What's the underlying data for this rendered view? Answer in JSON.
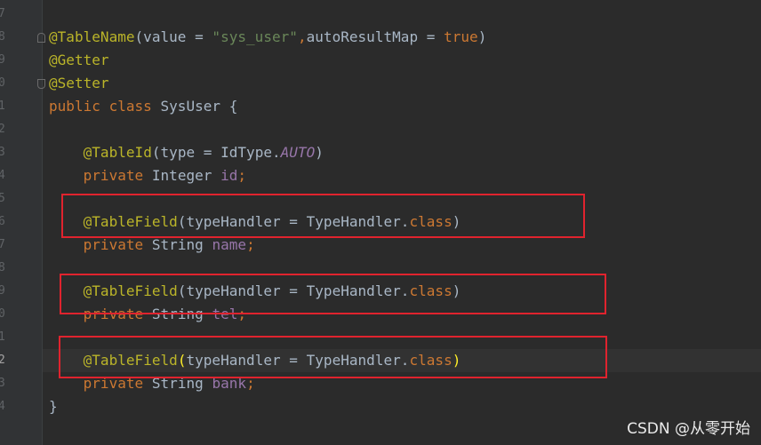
{
  "editor": {
    "line_numbers": [
      "7",
      "8",
      "9",
      "0",
      "1",
      "2",
      "3",
      "4",
      "5",
      "6",
      "7",
      "8",
      "9",
      "0",
      "1",
      "2",
      "3",
      "4"
    ],
    "active_line_index": 15,
    "lines": [
      [],
      [
        [
          "ann",
          "@TableName"
        ],
        [
          "plain",
          "(value = "
        ],
        [
          "str",
          "\"sys_user\""
        ],
        [
          "kw",
          ","
        ],
        [
          "plain",
          "autoResultMap = "
        ],
        [
          "kw",
          "true"
        ],
        [
          "plain",
          ")"
        ]
      ],
      [
        [
          "ann",
          "@Getter"
        ]
      ],
      [
        [
          "ann",
          "@Setter"
        ]
      ],
      [
        [
          "kw",
          "public class "
        ],
        [
          "plain",
          "SysUser {"
        ]
      ],
      [],
      [
        [
          "plain",
          "    "
        ],
        [
          "ann",
          "@TableId"
        ],
        [
          "plain",
          "(type = IdType."
        ],
        [
          "italic",
          "AUTO"
        ],
        [
          "plain",
          ")"
        ]
      ],
      [
        [
          "plain",
          "    "
        ],
        [
          "kw",
          "private "
        ],
        [
          "plain",
          "Integer "
        ],
        [
          "fld",
          "id"
        ],
        [
          "kw",
          ";"
        ]
      ],
      [],
      [
        [
          "plain",
          "    "
        ],
        [
          "ann",
          "@TableField"
        ],
        [
          "plain",
          "(typeHandler = TypeHandler."
        ],
        [
          "kw",
          "class"
        ],
        [
          "plain",
          ")"
        ]
      ],
      [
        [
          "plain",
          "    "
        ],
        [
          "kw",
          "private "
        ],
        [
          "plain",
          "String "
        ],
        [
          "fld",
          "name"
        ],
        [
          "kw",
          ";"
        ]
      ],
      [],
      [
        [
          "plain",
          "    "
        ],
        [
          "ann",
          "@TableField"
        ],
        [
          "plain",
          "(typeHandler = TypeHandler."
        ],
        [
          "kw",
          "class"
        ],
        [
          "plain",
          ")"
        ]
      ],
      [
        [
          "plain",
          "    "
        ],
        [
          "kw",
          "private "
        ],
        [
          "plain",
          "String "
        ],
        [
          "fld",
          "tel"
        ],
        [
          "kw",
          ";"
        ]
      ],
      [],
      [
        [
          "plain",
          "    "
        ],
        [
          "ann",
          "@TableField"
        ],
        [
          "bracket-y",
          "("
        ],
        [
          "plain",
          "typeHandler = TypeHandler."
        ],
        [
          "kw",
          "class"
        ],
        [
          "bracket-y",
          ")"
        ]
      ],
      [
        [
          "plain",
          "    "
        ],
        [
          "kw",
          "private "
        ],
        [
          "plain",
          "String "
        ],
        [
          "fld",
          "bank"
        ],
        [
          "kw",
          ";"
        ]
      ],
      [
        [
          "plain",
          "}"
        ]
      ]
    ]
  },
  "watermark": "CSDN @从零开始",
  "colors": {
    "background": "#2b2b2b",
    "annotation": "#bbb529",
    "keyword": "#cc7832",
    "string": "#6a8759",
    "field": "#9876aa",
    "highlight_box": "#e0232e"
  }
}
